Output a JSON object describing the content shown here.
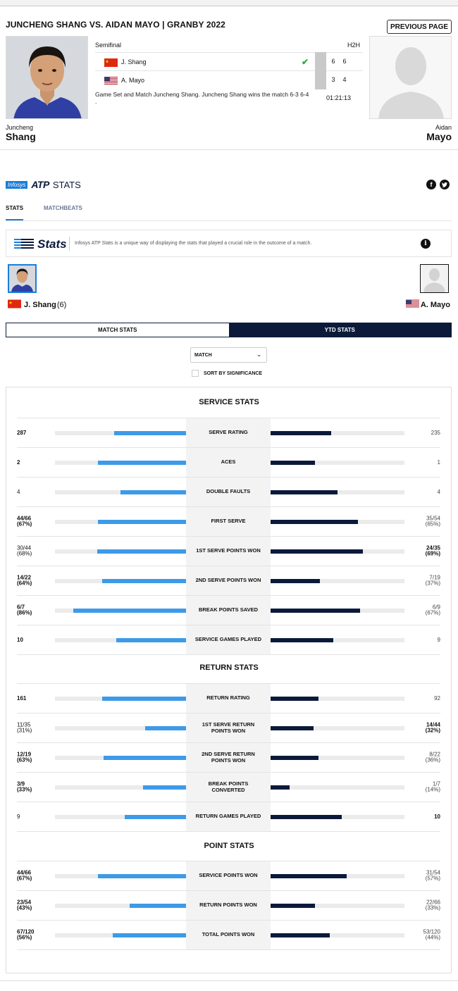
{
  "header": {
    "title": "JUNCHENG SHANG VS. AIDAN MAYO | GRANBY 2022",
    "previous_page": "PREVIOUS PAGE"
  },
  "match": {
    "round": "Semifinal",
    "h2h": "H2H",
    "players": [
      {
        "name": "J. Shang",
        "flag": "china-flag",
        "sets": [
          "6",
          "6"
        ],
        "winner": true
      },
      {
        "name": "A. Mayo",
        "flag": "usa-flag",
        "sets": [
          "3",
          "4"
        ],
        "winner": false
      }
    ],
    "description": "Game Set and Match Juncheng Shang. Juncheng Shang wins the match 6-3 6-4 .",
    "duration": "01:21:13"
  },
  "player_left": {
    "first": "Juncheng",
    "last": "Shang"
  },
  "player_right": {
    "first": "Aidan",
    "last": "Mayo"
  },
  "brand": {
    "infosys": "Infosys",
    "atp": "ATP",
    "stats": "STATS"
  },
  "tabs": [
    {
      "label": "STATS"
    },
    {
      "label": "MATCHBEATS"
    }
  ],
  "info": {
    "logo_text": "Stats",
    "text": "Infosys ATP Stats is a unique way of displaying the stats that played a crucial role in the outcome of a match."
  },
  "compare": {
    "left_name": "J. Shang",
    "left_seed": "(6)",
    "right_name": "A. Mayo"
  },
  "toggle": {
    "match_stats": "MATCH STATS",
    "ytd_stats": "YTD STATS"
  },
  "select": {
    "value": "MATCH"
  },
  "sort_label": "SORT BY SIGNIFICANCE",
  "colors": {
    "left_bar": "#3d9ae8",
    "right_bar": "#0b1a3a",
    "dark": "#0b1a3a"
  },
  "sections": [
    {
      "title": "SERVICE STATS",
      "rows": [
        {
          "label": "SERVE RATING",
          "left": "287",
          "left_sub": "",
          "right": "235",
          "right_sub": "",
          "left_bold": true,
          "right_bold": false,
          "left_ratio": 0.55,
          "right_ratio": 0.45
        },
        {
          "label": "ACES",
          "left": "2",
          "left_sub": "",
          "right": "1",
          "right_sub": "",
          "left_bold": true,
          "right_bold": false,
          "left_ratio": 0.67,
          "right_ratio": 0.33
        },
        {
          "label": "DOUBLE FAULTS",
          "left": "4",
          "left_sub": "",
          "right": "4",
          "right_sub": "",
          "left_bold": false,
          "right_bold": false,
          "left_ratio": 0.5,
          "right_ratio": 0.5
        },
        {
          "label": "FIRST SERVE",
          "left": "44/66",
          "left_sub": "(67%)",
          "right": "35/54",
          "right_sub": "(65%)",
          "left_bold": true,
          "right_bold": false,
          "left_ratio": 0.67,
          "right_ratio": 0.65
        },
        {
          "label": "1ST SERVE POINTS WON",
          "left": "30/44",
          "left_sub": "(68%)",
          "right": "24/35",
          "right_sub": "(69%)",
          "left_bold": false,
          "right_bold": true,
          "left_ratio": 0.68,
          "right_ratio": 0.69
        },
        {
          "label": "2ND SERVE POINTS WON",
          "left": "14/22",
          "left_sub": "(64%)",
          "right": "7/19",
          "right_sub": "(37%)",
          "left_bold": true,
          "right_bold": false,
          "left_ratio": 0.64,
          "right_ratio": 0.37
        },
        {
          "label": "BREAK POINTS SAVED",
          "left": "6/7",
          "left_sub": "(86%)",
          "right": "6/9",
          "right_sub": "(67%)",
          "left_bold": true,
          "right_bold": false,
          "left_ratio": 0.86,
          "right_ratio": 0.67
        },
        {
          "label": "SERVICE GAMES PLAYED",
          "left": "10",
          "left_sub": "",
          "right": "9",
          "right_sub": "",
          "left_bold": true,
          "right_bold": false,
          "left_ratio": 0.53,
          "right_ratio": 0.47
        }
      ]
    },
    {
      "title": "RETURN STATS",
      "rows": [
        {
          "label": "RETURN RATING",
          "left": "161",
          "left_sub": "",
          "right": "92",
          "right_sub": "",
          "left_bold": true,
          "right_bold": false,
          "left_ratio": 0.64,
          "right_ratio": 0.36
        },
        {
          "label": "1ST SERVE RETURN POINTS WON",
          "left": "11/35",
          "left_sub": "(31%)",
          "right": "14/44",
          "right_sub": "(32%)",
          "left_bold": false,
          "right_bold": true,
          "left_ratio": 0.31,
          "right_ratio": 0.32
        },
        {
          "label": "2ND SERVE RETURN POINTS WON",
          "left": "12/19",
          "left_sub": "(63%)",
          "right": "8/22",
          "right_sub": "(36%)",
          "left_bold": true,
          "right_bold": false,
          "left_ratio": 0.63,
          "right_ratio": 0.36
        },
        {
          "label": "BREAK POINTS CONVERTED",
          "left": "3/9",
          "left_sub": "(33%)",
          "right": "1/7",
          "right_sub": "(14%)",
          "left_bold": true,
          "right_bold": false,
          "left_ratio": 0.33,
          "right_ratio": 0.14
        },
        {
          "label": "RETURN GAMES PLAYED",
          "left": "9",
          "left_sub": "",
          "right": "10",
          "right_sub": "",
          "left_bold": false,
          "right_bold": true,
          "left_ratio": 0.47,
          "right_ratio": 0.53
        }
      ]
    },
    {
      "title": "POINT STATS",
      "rows": [
        {
          "label": "SERVICE POINTS WON",
          "left": "44/66",
          "left_sub": "(67%)",
          "right": "31/54",
          "right_sub": "(57%)",
          "left_bold": true,
          "right_bold": false,
          "left_ratio": 0.67,
          "right_ratio": 0.57
        },
        {
          "label": "RETURN POINTS WON",
          "left": "23/54",
          "left_sub": "(43%)",
          "right": "22/66",
          "right_sub": "(33%)",
          "left_bold": true,
          "right_bold": false,
          "left_ratio": 0.43,
          "right_ratio": 0.33
        },
        {
          "label": "TOTAL POINTS WON",
          "left": "67/120",
          "left_sub": "(56%)",
          "right": "53/120",
          "right_sub": "(44%)",
          "left_bold": true,
          "right_bold": false,
          "left_ratio": 0.56,
          "right_ratio": 0.44
        }
      ]
    }
  ]
}
